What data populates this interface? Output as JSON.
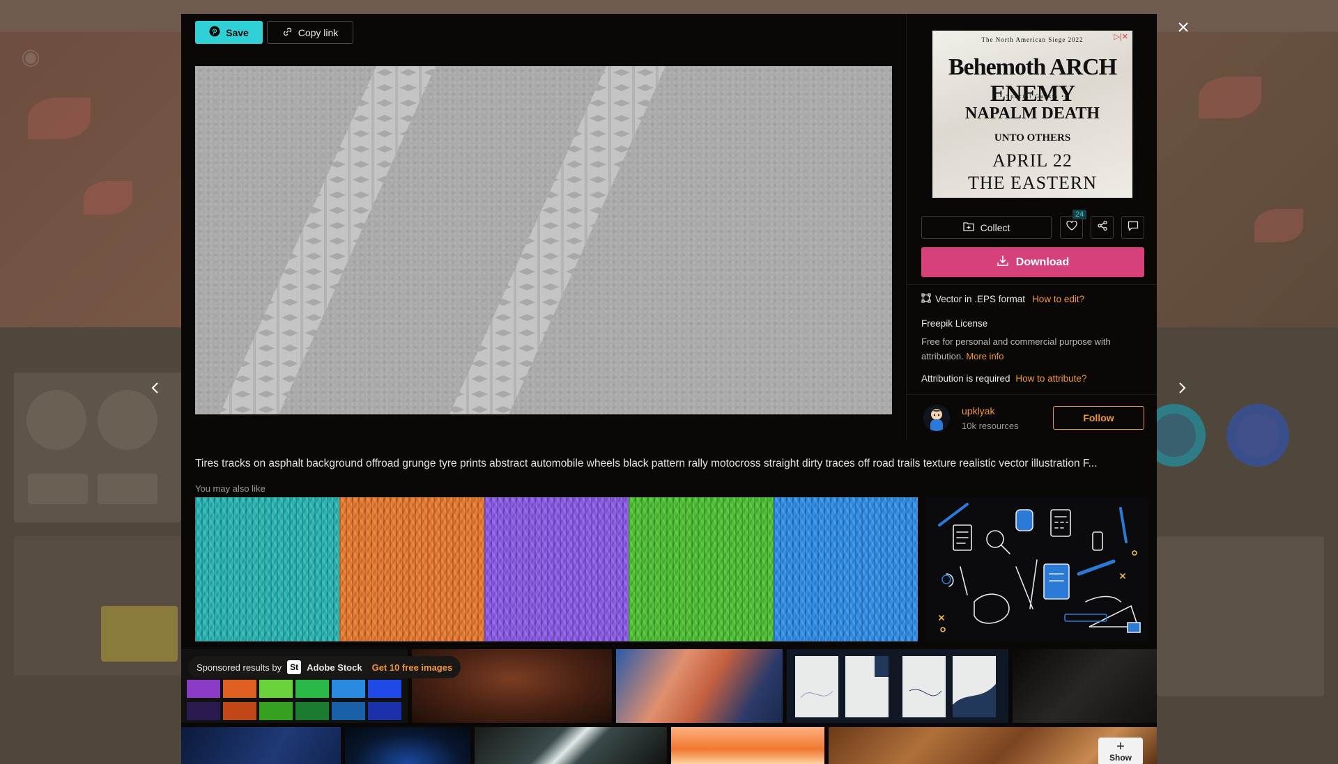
{
  "toolbar": {
    "save_label": "Save",
    "copy_link_label": "Copy link"
  },
  "ad": {
    "badge": "▷|✕",
    "tour": "The North American Siege 2022",
    "headliners": "Behemoth ARCH ENEMY",
    "special": "• Special Guests •",
    "guest1": "NAPALM DEATH",
    "guest2": "UNTO OTHERS",
    "date": "APRIL 22",
    "venue": "THE EASTERN"
  },
  "actions": {
    "collect_label": "Collect",
    "like_count": "24",
    "download_label": "Download"
  },
  "details": {
    "format": "Vector in .EPS format",
    "how_to_edit": "How to edit?",
    "license_title": "Freepik License",
    "license_text": "Free for personal and commercial purpose with attribution.",
    "more_info": "More info",
    "attribution": "Attribution is required",
    "how_to_attribute": "How to attribute?"
  },
  "author": {
    "name": "upklyak",
    "resources": "10k resources",
    "follow_label": "Follow"
  },
  "resource": {
    "title": "Tires tracks on asphalt background offroad grunge tyre prints abstract automobile wheels black pattern rally motocross straight dirty traces off road trails texture realistic vector illustration F..."
  },
  "related": {
    "heading": "You may also like",
    "knit_colors": [
      "#27b6b4",
      "#e87a2e",
      "#8a5ae8",
      "#4cc232",
      "#2f8ee8"
    ]
  },
  "sponsored": {
    "prefix": "Sponsored results by",
    "brand_mark": "St",
    "brand": "Adobe Stock",
    "offer": "Get 10 free images",
    "show_label": "Show"
  },
  "colors": {
    "accent_cyan": "#2fd0d6",
    "download_pink": "#d6417b",
    "link_orange": "#f0963c"
  }
}
